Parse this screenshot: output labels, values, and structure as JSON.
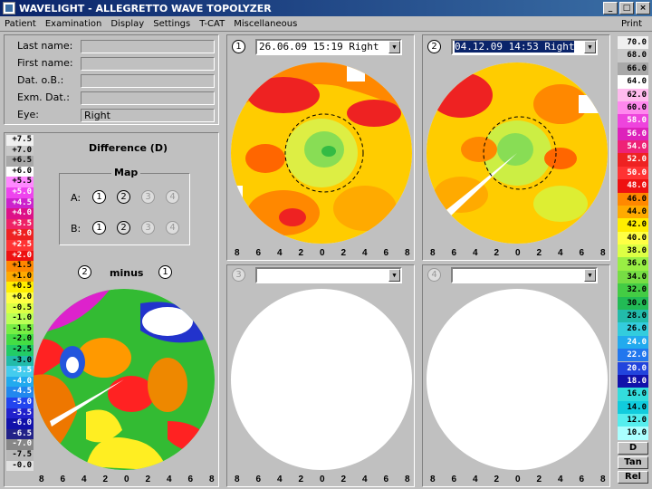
{
  "window": {
    "title": "WAVELIGHT  -  ALLEGRETTO WAVE TOPOLYZER",
    "btn_min": "_",
    "btn_max": "□",
    "btn_close": "×"
  },
  "menu": {
    "items": [
      "Patient",
      "Examination",
      "Display",
      "Settings",
      "T-CAT",
      "Miscellaneous"
    ],
    "print": "Print"
  },
  "patient": {
    "labels": {
      "last_name": "Last name:",
      "first_name": "First name:",
      "dob": "Dat. o.B.:",
      "exam_date": "Exm. Dat.:",
      "eye": "Eye:"
    },
    "values": {
      "last_name": "",
      "first_name": "",
      "dob": "",
      "exam_date": "",
      "eye": "Right"
    }
  },
  "difference": {
    "title": "Difference (D)",
    "map_label": "Map",
    "row_a_label": "A:",
    "row_b_label": "B:",
    "buttons": [
      "1",
      "2",
      "3",
      "4"
    ],
    "minus_label": "minus",
    "minus_left": "2",
    "minus_right": "1"
  },
  "diff_scale": [
    "+7.5",
    "+7.0",
    "+6.5",
    "+6.0",
    "+5.5",
    "+5.0",
    "+4.5",
    "+4.0",
    "+3.5",
    "+3.0",
    "+2.5",
    "+2.0",
    "+1.5",
    "+1.0",
    "+0.5",
    "+0.0",
    "-0.5",
    "-1.0",
    "-1.5",
    "-2.0",
    "-2.5",
    "-3.0",
    "-3.5",
    "-4.0",
    "-4.5",
    "-5.0",
    "-5.5",
    "-6.0",
    "-6.5",
    "-7.0",
    "-7.5",
    "-0.0"
  ],
  "diff_scale_colors": [
    "#f0f0f0",
    "#c8c8c8",
    "#a8a8a8",
    "#ffffff",
    "#ff88ff",
    "#ee44ee",
    "#cc22cc",
    "#dd1188",
    "#ee2266",
    "#ee2222",
    "#ff3333",
    "#ee1111",
    "#ff8800",
    "#ffaa00",
    "#ffee00",
    "#ffff44",
    "#ddff44",
    "#bbff55",
    "#77ee44",
    "#44dd44",
    "#22cc66",
    "#22bbaa",
    "#44ccee",
    "#22aaee",
    "#2288ee",
    "#2244ee",
    "#2222cc",
    "#1111aa",
    "#222288",
    "#888888",
    "#b8b8b8",
    "#e0e0e0"
  ],
  "views": [
    {
      "num": "1",
      "dropdown": "26.06.09  15:19 Right",
      "active": false
    },
    {
      "num": "2",
      "dropdown": "04.12.09  14:53 Right",
      "active": true
    },
    {
      "num": "3",
      "dropdown": "",
      "active": false
    },
    {
      "num": "4",
      "dropdown": "",
      "active": false
    }
  ],
  "axis_labels": [
    "8",
    "6",
    "4",
    "2",
    "0",
    "2",
    "4",
    "6",
    "8"
  ],
  "right_scale": [
    "70.0",
    "68.0",
    "66.0",
    "64.0",
    "62.0",
    "60.0",
    "58.0",
    "56.0",
    "54.0",
    "52.0",
    "50.0",
    "48.0",
    "46.0",
    "44.0",
    "42.0",
    "40.0",
    "38.0",
    "36.0",
    "34.0",
    "32.0",
    "30.0",
    "28.0",
    "26.0",
    "24.0",
    "22.0",
    "20.0",
    "18.0",
    "16.0",
    "14.0",
    "12.0",
    "10.0"
  ],
  "right_scale_colors": [
    "#f0f0f0",
    "#c8c8c8",
    "#a8a8a8",
    "#ffffff",
    "#ffbbee",
    "#ff88ee",
    "#ee44dd",
    "#dd22bb",
    "#ee2277",
    "#ee2222",
    "#ff3333",
    "#ee1111",
    "#ff8800",
    "#ffaa00",
    "#ffee00",
    "#ffff44",
    "#ddff44",
    "#99ee44",
    "#77dd44",
    "#44cc44",
    "#22bb55",
    "#22bbaa",
    "#33ccdd",
    "#22aaee",
    "#2277ee",
    "#2244dd",
    "#1111aa",
    "#33dddd",
    "#11ccdd",
    "#55eeee",
    "#aaffff"
  ],
  "right_buttons": [
    "D",
    "Tan",
    "Rel"
  ]
}
